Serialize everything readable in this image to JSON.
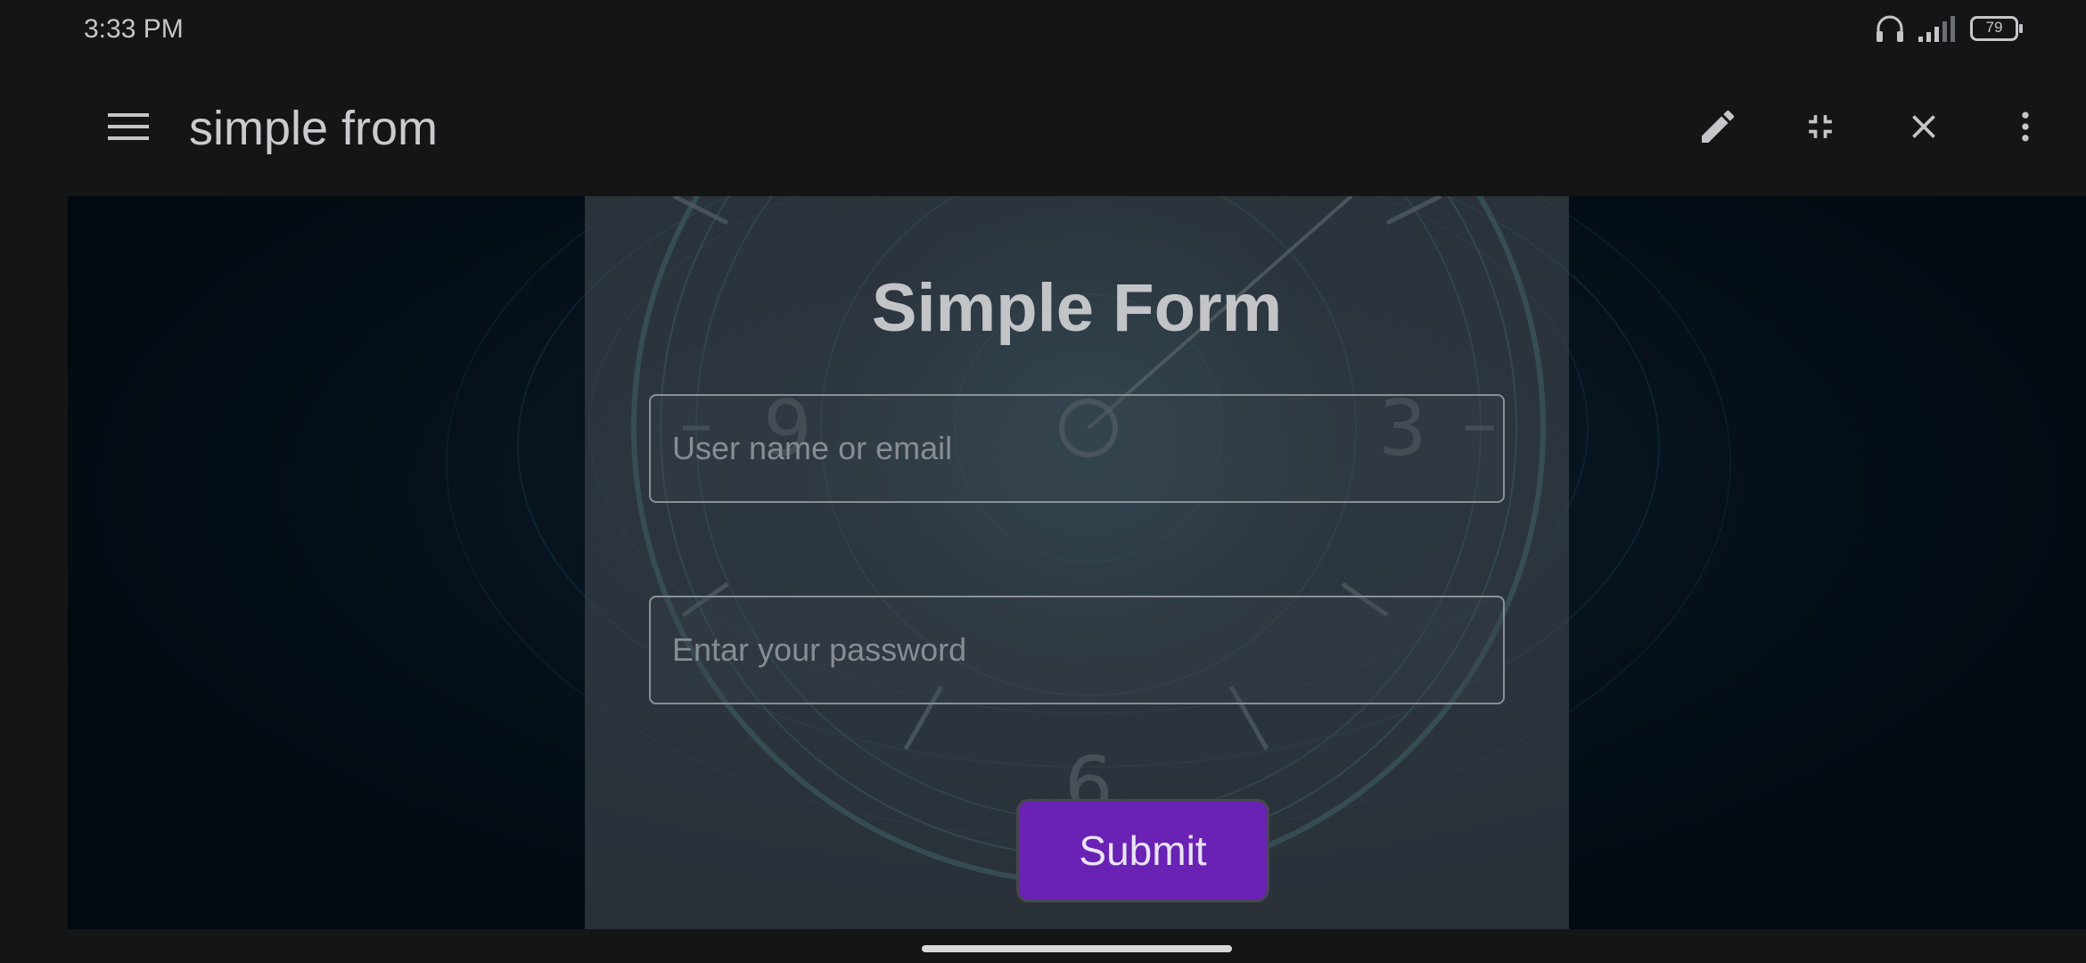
{
  "status_bar": {
    "time": "3:33 PM",
    "battery": "79",
    "icons": [
      "headphones-icon",
      "signal-icon",
      "battery-icon"
    ]
  },
  "app_bar": {
    "title": "simple from",
    "icons": [
      "menu-icon",
      "edit-icon",
      "collapse-icon",
      "close-icon",
      "more-vert-icon"
    ]
  },
  "form": {
    "title": "Simple Form",
    "username_placeholder": "User name or email",
    "password_placeholder": "Entar your password",
    "submit_label": "Submit"
  },
  "background_clock": {
    "numerals": [
      "9",
      "3",
      "6"
    ]
  },
  "colors": {
    "accent": "#6a22b5",
    "app_bg": "#141517",
    "panel": "#424850"
  }
}
